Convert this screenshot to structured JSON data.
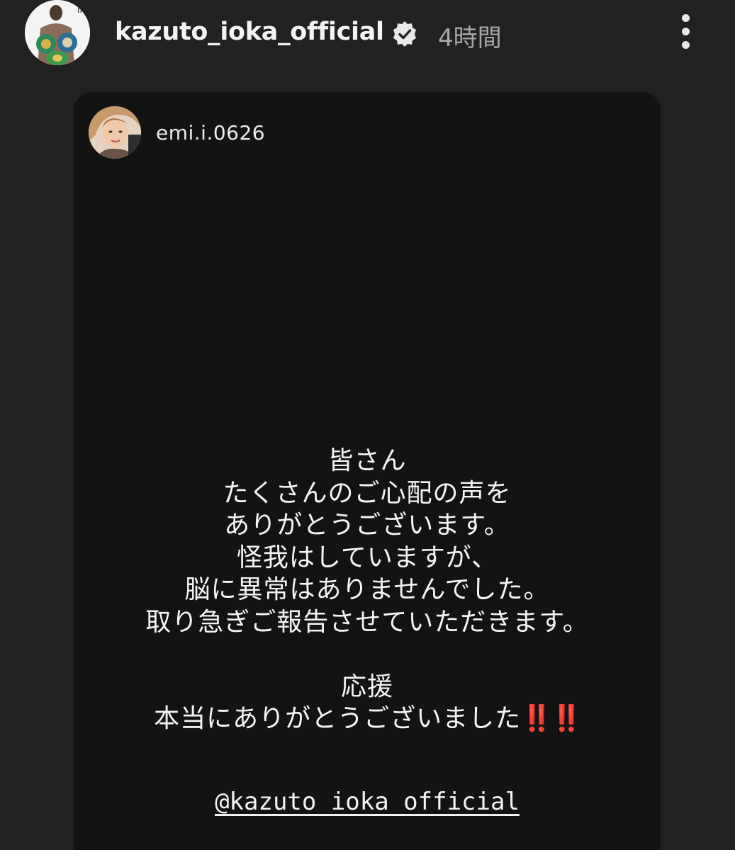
{
  "header": {
    "username": "kazuto_ioka_official",
    "verified_icon": "verified-badge-icon",
    "timestamp": "4時間",
    "more_icon": "more-vertical-icon"
  },
  "story": {
    "author": "emi.i.0626",
    "message": {
      "lines": [
        "皆さん",
        "たくさんのご心配の声を",
        "ありがとうございます。",
        "怪我はしていますが、",
        "脳に異常はありませんでした。",
        "取り急ぎご報告させていただきます。",
        "",
        "応援"
      ],
      "last_line_text": "本当にありがとうございました",
      "last_line_emoji": "‼️‼️"
    },
    "mention": "@kazuto_ioka_official"
  },
  "colors": {
    "background": "#212121",
    "card": "#131313",
    "text": "#f5f5f5",
    "muted": "#a8a8a8",
    "emoji_red": "#e0201b"
  }
}
